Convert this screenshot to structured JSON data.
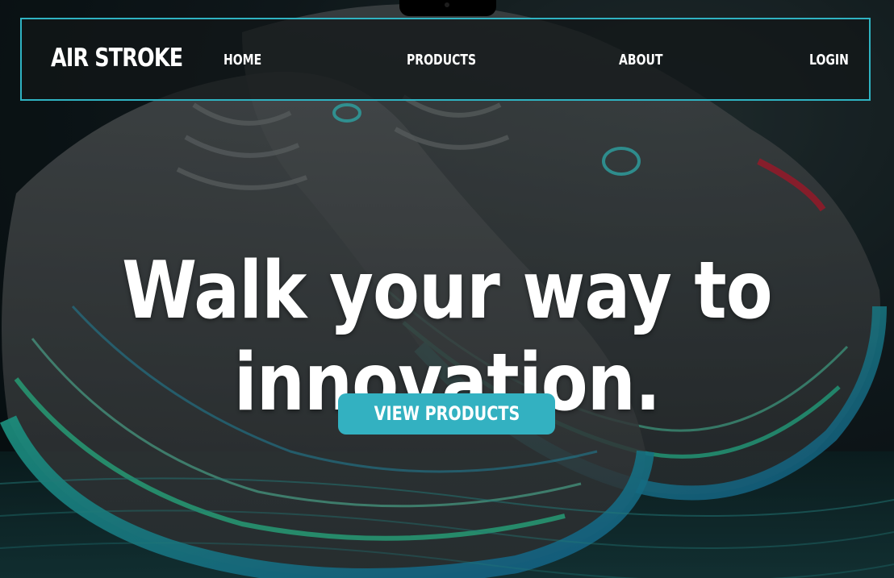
{
  "brand": {
    "name": "AIR STROKE"
  },
  "nav": {
    "items": [
      {
        "label": "HOME"
      },
      {
        "label": "PRODUCTS"
      },
      {
        "label": "ABOUT"
      },
      {
        "label": "LOGIN"
      }
    ]
  },
  "hero": {
    "headline_line1": "Walk your way to",
    "headline_line2": "innovation.",
    "cta_label": "VIEW PRODUCTS",
    "background_image": "sneaker-hero-image"
  },
  "colors": {
    "accent": "#33b1c1",
    "nav_border": "#2fb3c2",
    "text": "#ffffff",
    "background": "#0b1215"
  }
}
